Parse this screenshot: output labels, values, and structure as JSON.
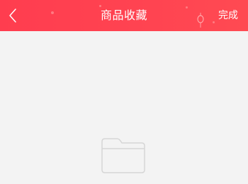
{
  "header": {
    "back_icon": "chevron-left-icon",
    "title": "商品收藏",
    "done_label": "完成",
    "background_color": "#ff4351",
    "text_color": "#ffffff"
  },
  "content": {
    "background_color": "#f3f3f3",
    "empty_state_icon": "folder-icon"
  }
}
